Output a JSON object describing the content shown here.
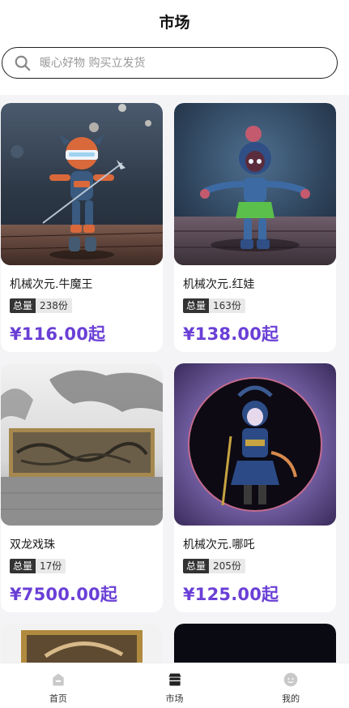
{
  "header": {
    "title": "市场"
  },
  "search": {
    "placeholder": "暖心好物 购买立发货"
  },
  "products": [
    {
      "name": "机械次元.牛魔王",
      "qty_label": "总量",
      "qty": "238份",
      "price": "¥116.00起"
    },
    {
      "name": "机械次元.红娃",
      "qty_label": "总量",
      "qty": "163份",
      "price": "¥138.00起"
    },
    {
      "name": "双龙戏珠",
      "qty_label": "总量",
      "qty": "17份",
      "price": "¥7500.00起"
    },
    {
      "name": "机械次元.哪吒",
      "qty_label": "总量",
      "qty": "205份",
      "price": "¥125.00起"
    }
  ],
  "tabbar": {
    "items": [
      {
        "label": "首页",
        "icon": "home-icon"
      },
      {
        "label": "市场",
        "icon": "market-icon",
        "active": true
      },
      {
        "label": "我的",
        "icon": "profile-icon"
      }
    ]
  },
  "colors": {
    "price": "#6a3fd6",
    "background": "#f4f4f7"
  }
}
